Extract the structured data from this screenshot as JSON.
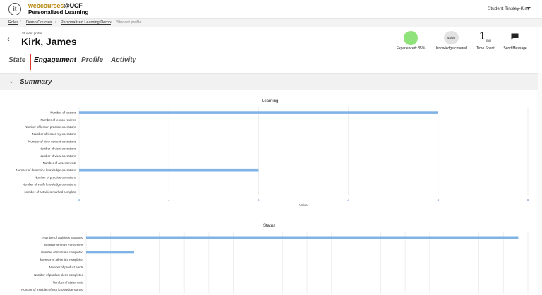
{
  "header": {
    "logo_text": "it",
    "brand_line1_a": "webcourses",
    "brand_line1_b": "@UCF",
    "brand_line2": "Personalized Learning",
    "user_name": "Student Tinsley-Kim"
  },
  "breadcrumbs": [
    "Roles",
    "Demo Courses",
    "Personalized Learning Demo",
    "Student profile"
  ],
  "profile": {
    "label": "Student profile",
    "name": "Kirk, James"
  },
  "stats": {
    "experienced_label": "Experienced: 85%",
    "knowledge_value": "44/60",
    "knowledge_label": "Knowledge covered",
    "time_value": "1",
    "time_unit": "min",
    "time_label": "Time Spent",
    "message_label": "Send Message"
  },
  "tabs": [
    "State",
    "Engagement",
    "Profile",
    "Activity"
  ],
  "section": {
    "title": "Summary"
  },
  "colors": {
    "bar": "#7fb3e6",
    "experienced": "#90e27a",
    "highlight": "#e03a2f"
  },
  "chart_data": [
    {
      "type": "bar",
      "orientation": "horizontal",
      "title": "Learning",
      "xlabel": "Value",
      "xlim": [
        0,
        5
      ],
      "xticks": [
        0,
        1,
        2,
        3,
        4,
        5
      ],
      "categories": [
        "Number of lessons",
        "Number of lesson reviews",
        "Number of lesson practice operations",
        "Number of lesson try operations",
        "Number of view content operations",
        "Number of view operations",
        "Number of view operations",
        "Number of assessments",
        "Number of determine knowledge operations",
        "Number of practice operations",
        "Number of verify knowledge operations",
        "Number of activities marked complete"
      ],
      "values": [
        4,
        0,
        0,
        0,
        0,
        0,
        0,
        0,
        2,
        0,
        0,
        0
      ]
    },
    {
      "type": "bar",
      "orientation": "horizontal",
      "title": "Status",
      "categories": [
        "Number of activities assumed",
        "Number of score corrections",
        "Number of modules completed",
        "Number of attributes completed",
        "Number of product alerts",
        "Number of product alerts completed",
        "Number of statements",
        "Number of module refresh knowledge started"
      ],
      "values": [
        9,
        0,
        1,
        0,
        0,
        0,
        0,
        0
      ],
      "xlim": [
        0,
        9.2
      ]
    }
  ]
}
